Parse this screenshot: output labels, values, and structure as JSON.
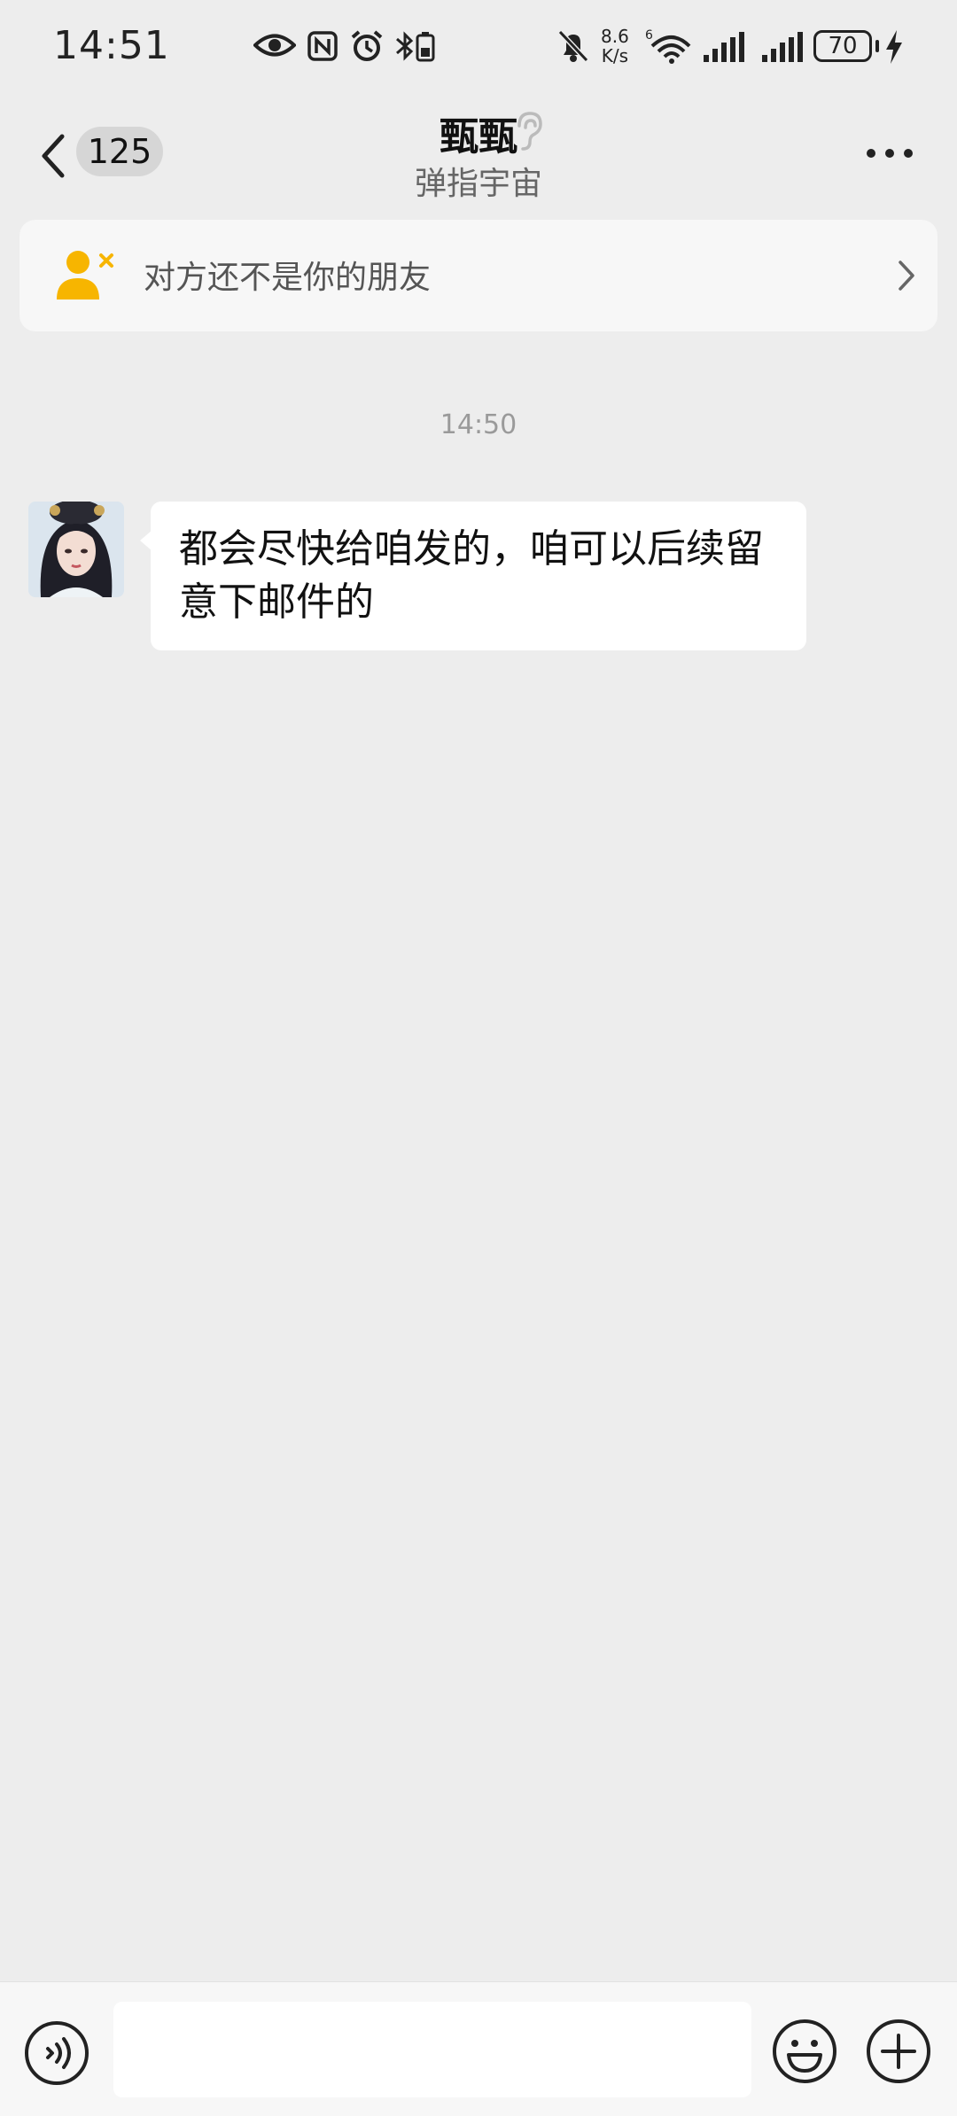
{
  "status_bar": {
    "time": "14:51",
    "net_speed_value": "8.6",
    "net_speed_unit": "K/s",
    "battery": "70",
    "icons": [
      "eye-icon",
      "nfc-icon",
      "alarm-icon",
      "bluetooth-battery-icon",
      "bell-off-icon",
      "wifi-6-icon",
      "signal-icon",
      "signal-icon",
      "charging-icon"
    ]
  },
  "header": {
    "unread_count": "125",
    "title": "甄甄",
    "subtitle": "弹指宇宙",
    "icons": [
      "back-icon",
      "ear-icon",
      "more-icon"
    ]
  },
  "banner": {
    "text": "对方还不是你的朋友",
    "icon": "user-x-icon",
    "accent": "#f7b500"
  },
  "chat": {
    "timestamp": "14:50",
    "messages": [
      {
        "text": "都会尽快给咱发的，咱可以后续留意下邮件的"
      }
    ]
  },
  "input_bar": {
    "message_value": "",
    "icons": [
      "voice-icon",
      "emoji-icon",
      "plus-icon"
    ]
  },
  "colors": {
    "background": "#ededed",
    "bubble": "#ffffff",
    "banner_bg": "#f7f7f7"
  }
}
